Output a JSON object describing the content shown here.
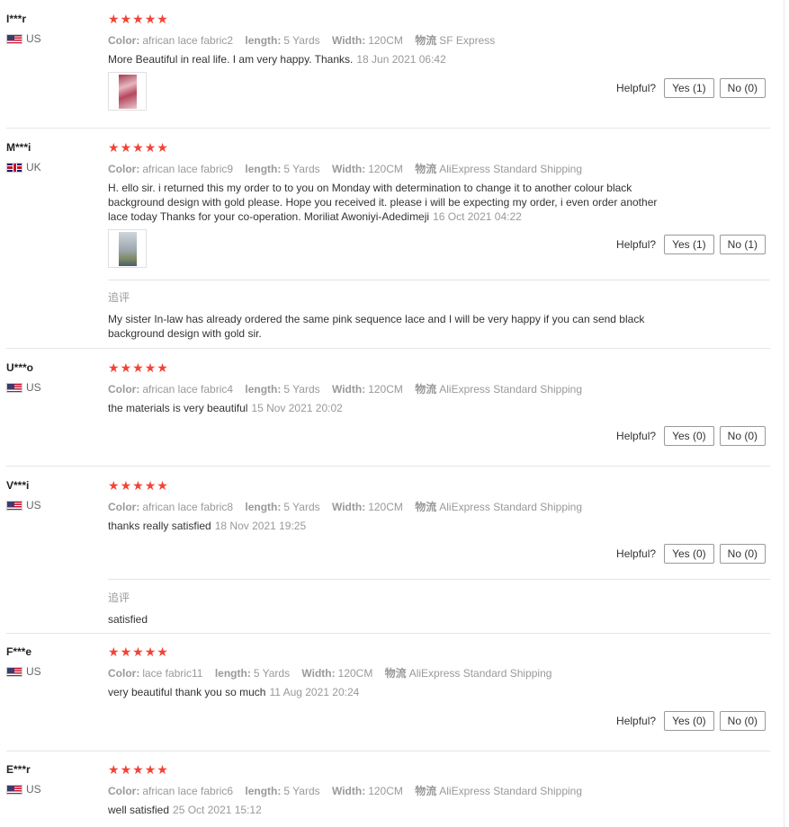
{
  "labels": {
    "color": "Color:",
    "length": "length:",
    "width": "Width:",
    "logistics": "物流",
    "helpful": "Helpful?",
    "additional_review": "追评"
  },
  "reviews": [
    {
      "user": "I***r",
      "country": "US",
      "rating": 5,
      "color": "african lace fabric2",
      "length": "5 Yards",
      "width": "120CM",
      "shipping": "SF Express",
      "text": "More Beautiful in real life. I am very happy. Thanks.",
      "date": "18 Jun 2021 06:42",
      "yes": "Yes (1)",
      "no": "No (0)"
    },
    {
      "user": "M***i",
      "country": "UK",
      "rating": 5,
      "color": "african lace fabric9",
      "length": "5 Yards",
      "width": "120CM",
      "shipping": "AliExpress Standard Shipping",
      "text": "H. ello sir. i returned this my order to to you on Monday with determination to change it to another colour black background design with gold please. Hope you received it. please i will be expecting my order, i even order another lace today Thanks for your co-operation. Moriliat Awoniyi-Adedimeji",
      "date": "16 Oct 2021 04:22",
      "yes": "Yes (1)",
      "no": "No (1)",
      "additional": "My sister In-law has already ordered the same pink sequence lace and I will be very happy if you can send black background design with gold sir."
    },
    {
      "user": "U***o",
      "country": "US",
      "rating": 5,
      "color": "african lace fabric4",
      "length": "5 Yards",
      "width": "120CM",
      "shipping": "AliExpress Standard Shipping",
      "text": "the materials is very beautiful",
      "date": "15 Nov 2021 20:02",
      "yes": "Yes (0)",
      "no": "No (0)"
    },
    {
      "user": "V***i",
      "country": "US",
      "rating": 5,
      "color": "african lace fabric8",
      "length": "5 Yards",
      "width": "120CM",
      "shipping": "AliExpress Standard Shipping",
      "text": "thanks really satisfied",
      "date": "18 Nov 2021 19:25",
      "yes": "Yes (0)",
      "no": "No (0)",
      "additional": "satisfied"
    },
    {
      "user": "F***e",
      "country": "US",
      "rating": 5,
      "color": "lace fabric11",
      "length": "5 Yards",
      "width": "120CM",
      "shipping": "AliExpress Standard Shipping",
      "text": "very beautiful thank you so much",
      "date": "11 Aug 2021 20:24",
      "yes": "Yes (0)",
      "no": "No (0)"
    },
    {
      "user": "E***r",
      "country": "US",
      "rating": 5,
      "color": "african lace fabric6",
      "length": "5 Yards",
      "width": "120CM",
      "shipping": "AliExpress Standard Shipping",
      "text": "well satisfied",
      "date": "25 Oct 2021 15:12"
    }
  ],
  "icons": {
    "star": "star-icon",
    "flag_us": "us-flag-icon",
    "flag_uk": "uk-flag-icon"
  },
  "colors": {
    "star": "#f44336",
    "muted": "#999999",
    "text": "#333333",
    "divider": "#e5e5e5"
  }
}
